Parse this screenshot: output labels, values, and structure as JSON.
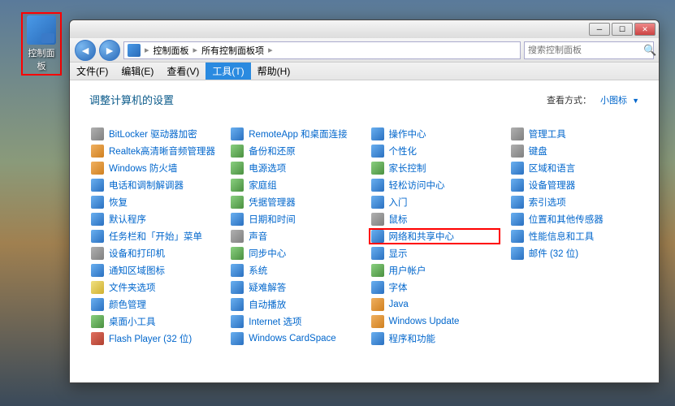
{
  "desktop_icon": {
    "label": "控制面板"
  },
  "window": {
    "breadcrumb": {
      "crumb1": "控制面板",
      "crumb2": "所有控制面板项"
    },
    "search_placeholder": "搜索控制面板",
    "menubar": {
      "file": "文件(F)",
      "edit": "编辑(E)",
      "view": "查看(V)",
      "tools": "工具(T)",
      "help": "帮助(H)"
    },
    "content_title": "调整计算机的设置",
    "view_label": "查看方式：",
    "view_value": "小图标",
    "items": [
      {
        "label": "BitLocker 驱动器加密",
        "color": "gray"
      },
      {
        "label": "Realtek高清晰音频管理器",
        "color": "orange"
      },
      {
        "label": "Windows 防火墙",
        "color": "orange"
      },
      {
        "label": "电话和调制解调器",
        "color": "blue"
      },
      {
        "label": "恢复",
        "color": "blue"
      },
      {
        "label": "默认程序",
        "color": "blue"
      },
      {
        "label": "任务栏和「开始」菜单",
        "color": "blue"
      },
      {
        "label": "设备和打印机",
        "color": "gray"
      },
      {
        "label": "通知区域图标",
        "color": "blue"
      },
      {
        "label": "文件夹选项",
        "color": "yellow"
      },
      {
        "label": "颜色管理",
        "color": "blue"
      },
      {
        "label": "桌面小工具",
        "color": "green"
      },
      {
        "label": "Flash Player (32 位)",
        "color": "red"
      },
      {
        "label": "RemoteApp 和桌面连接",
        "color": "blue"
      },
      {
        "label": "备份和还原",
        "color": "green"
      },
      {
        "label": "电源选项",
        "color": "green"
      },
      {
        "label": "家庭组",
        "color": "green"
      },
      {
        "label": "凭据管理器",
        "color": "green"
      },
      {
        "label": "日期和时间",
        "color": "blue"
      },
      {
        "label": "声音",
        "color": "gray"
      },
      {
        "label": "同步中心",
        "color": "green"
      },
      {
        "label": "系统",
        "color": "blue"
      },
      {
        "label": "疑难解答",
        "color": "blue"
      },
      {
        "label": "自动播放",
        "color": "blue"
      },
      {
        "label": "Internet 选项",
        "color": "blue"
      },
      {
        "label": "Windows CardSpace",
        "color": "blue"
      },
      {
        "label": "操作中心",
        "color": "blue"
      },
      {
        "label": "个性化",
        "color": "blue"
      },
      {
        "label": "家长控制",
        "color": "green"
      },
      {
        "label": "轻松访问中心",
        "color": "blue"
      },
      {
        "label": "入门",
        "color": "blue"
      },
      {
        "label": "鼠标",
        "color": "gray"
      },
      {
        "label": "网络和共享中心",
        "color": "blue",
        "highlight": true
      },
      {
        "label": "显示",
        "color": "blue"
      },
      {
        "label": "用户帐户",
        "color": "green"
      },
      {
        "label": "字体",
        "color": "blue"
      },
      {
        "label": "Java",
        "color": "orange"
      },
      {
        "label": "Windows Update",
        "color": "orange"
      },
      {
        "label": "程序和功能",
        "color": "blue"
      },
      {
        "label": "管理工具",
        "color": "gray"
      },
      {
        "label": "键盘",
        "color": "gray"
      },
      {
        "label": "区域和语言",
        "color": "blue"
      },
      {
        "label": "设备管理器",
        "color": "blue"
      },
      {
        "label": "索引选项",
        "color": "blue"
      },
      {
        "label": "位置和其他传感器",
        "color": "blue"
      },
      {
        "label": "性能信息和工具",
        "color": "blue"
      },
      {
        "label": "邮件 (32 位)",
        "color": "blue"
      }
    ]
  }
}
